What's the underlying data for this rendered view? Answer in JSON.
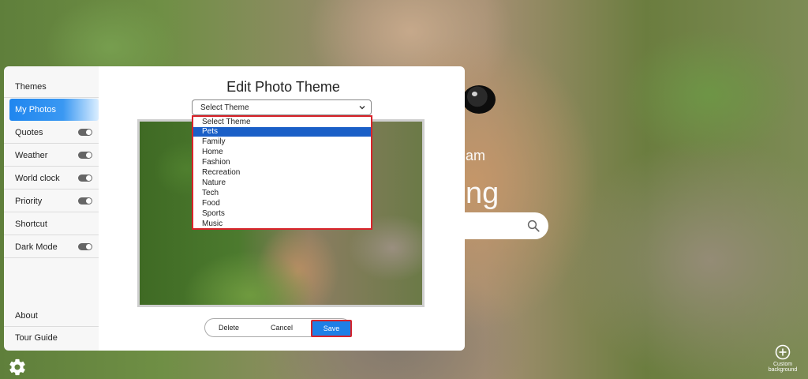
{
  "background": {
    "greeting_sub": "am",
    "greeting_main": "ng"
  },
  "sidebar": {
    "items": [
      {
        "label": "Themes",
        "toggle": false
      },
      {
        "label": "My Photos",
        "toggle": false,
        "active": true
      },
      {
        "label": "Quotes",
        "toggle": true
      },
      {
        "label": "Weather",
        "toggle": true
      },
      {
        "label": "World clock",
        "toggle": true
      },
      {
        "label": "Priority",
        "toggle": true
      },
      {
        "label": "Shortcut",
        "toggle": false
      },
      {
        "label": "Dark Mode",
        "toggle": true
      }
    ],
    "bottom_items": [
      {
        "label": "About"
      },
      {
        "label": "Tour Guide"
      }
    ]
  },
  "panel": {
    "title": "Edit Photo Theme",
    "select_value": "Select Theme",
    "dropdown_options": [
      "Select Theme",
      "Pets",
      "Family",
      "Home",
      "Fashion",
      "Recreation",
      "Nature",
      "Tech",
      "Food",
      "Sports",
      "Music"
    ],
    "selected_option": "Pets",
    "buttons": {
      "delete": "Delete",
      "cancel": "Cancel",
      "save": "Save"
    }
  },
  "custom_background": {
    "label_line1": "Custom",
    "label_line2": "background"
  },
  "colors": {
    "accent": "#1e7fe6",
    "highlight_border": "#d8232a",
    "selected_option": "#1a5fc7"
  }
}
